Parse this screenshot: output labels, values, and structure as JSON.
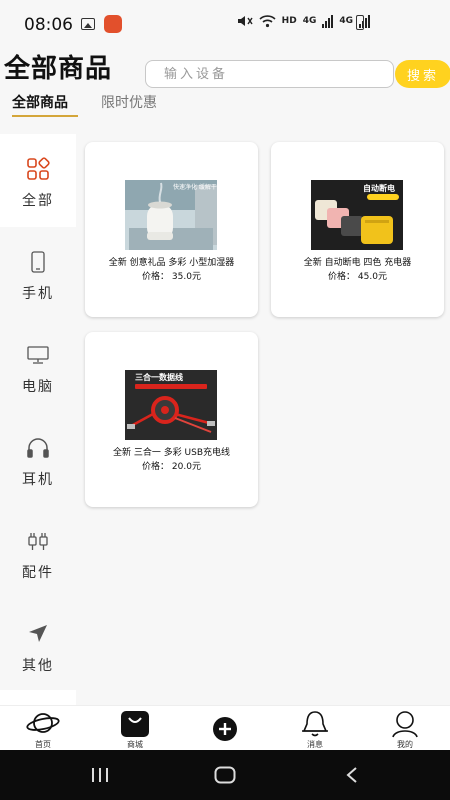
{
  "status_bar": {
    "time": "08:06",
    "network_hd": "HD",
    "network_4g_a": "4G",
    "network_4g_b": "4G"
  },
  "header": {
    "title": "全部商品",
    "search_placeholder": "输入设备",
    "search_button": "搜索"
  },
  "tabs": [
    {
      "label": "全部商品",
      "active": true
    },
    {
      "label": "限时优惠",
      "active": false
    }
  ],
  "sidebar": {
    "items": [
      {
        "label": "全部",
        "icon": "grid-icon",
        "active": true
      },
      {
        "label": "手机",
        "icon": "phone-icon",
        "active": false
      },
      {
        "label": "电脑",
        "icon": "monitor-icon",
        "active": false
      },
      {
        "label": "耳机",
        "icon": "headphones-icon",
        "active": false
      },
      {
        "label": "配件",
        "icon": "plug-icon",
        "active": false
      },
      {
        "label": "其他",
        "icon": "navigation-arrow-icon",
        "active": false
      }
    ]
  },
  "products": [
    {
      "name": "全新 创意礼品 多彩 小型加湿器",
      "price": "价格： 35.0元",
      "image_text": "快速净化 缓解干燥"
    },
    {
      "name": "全新 自动断电 四色 充电器",
      "price": "价格： 45.0元",
      "image_text": "自动断电"
    },
    {
      "name": "全新 三合一 多彩 USB充电线",
      "price": "价格： 20.0元",
      "image_text": "三合一数据线"
    }
  ],
  "bottom_nav": {
    "items": [
      {
        "label": "首页",
        "icon": "planet-icon"
      },
      {
        "label": "商城",
        "icon": "shopping-bag-icon"
      },
      {
        "label": "",
        "icon": "add-icon"
      },
      {
        "label": "消息",
        "icon": "bell-icon"
      },
      {
        "label": "我的",
        "icon": "user-icon"
      }
    ]
  },
  "colors": {
    "accent": "#ffd21f",
    "tab_underline": "#d4a63a",
    "background": "#f7f7f7"
  }
}
